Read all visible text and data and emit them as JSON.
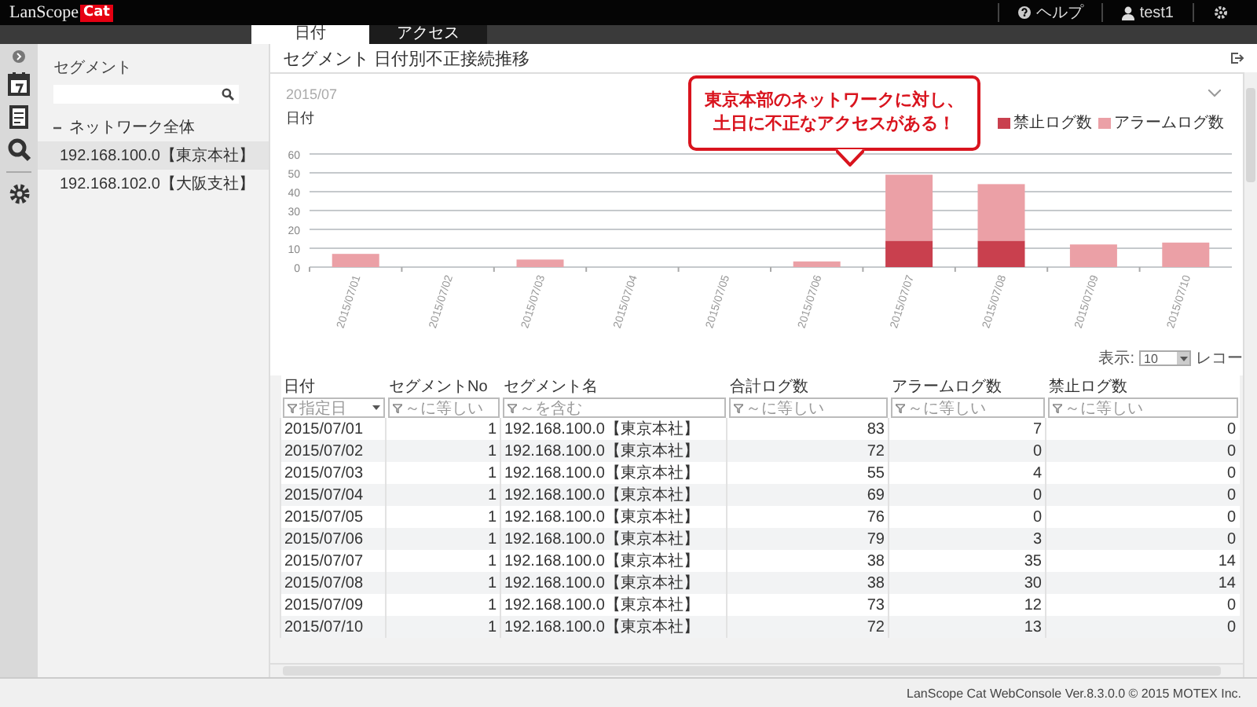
{
  "header": {
    "logo": "LanScope",
    "logo_badge": "Cat",
    "help": "ヘルプ",
    "user": "test1"
  },
  "tabs": [
    {
      "label": "日付",
      "selected": true
    },
    {
      "label": "アクセス",
      "selected": false
    }
  ],
  "sidebar": {
    "title": "セグメント",
    "tree": [
      {
        "label": "ネットワーク全体",
        "expanded": true,
        "children": [
          {
            "label": "192.168.100.0【東京本社】",
            "selected": true
          },
          {
            "label": "192.168.102.0【大阪支社】",
            "selected": false
          }
        ]
      }
    ]
  },
  "main": {
    "title": "セグメント 日付別不正接続推移",
    "period": "2015/07",
    "axis_caption": "日付",
    "callout": [
      "東京本部のネットワークに対し、",
      "土日に不正なアクセスがある！"
    ],
    "chart_data": {
      "type": "bar",
      "stacked": true,
      "categories": [
        "2015/07/01",
        "2015/07/02",
        "2015/07/03",
        "2015/07/04",
        "2015/07/05",
        "2015/07/06",
        "2015/07/07",
        "2015/07/08",
        "2015/07/09",
        "2015/07/10"
      ],
      "series": [
        {
          "name": "禁止ログ数",
          "color": "#c9404e",
          "values": [
            0,
            0,
            0,
            0,
            0,
            0,
            14,
            14,
            0,
            0
          ]
        },
        {
          "name": "アラームログ数",
          "color": "#eba0a6",
          "values": [
            7,
            0,
            4,
            0,
            0,
            3,
            35,
            30,
            12,
            13
          ]
        }
      ],
      "grid": true,
      "ylim": [
        0,
        60
      ],
      "yticks": [
        0,
        10,
        20,
        30,
        40,
        50,
        60
      ]
    },
    "page_size": {
      "label": "表示:",
      "value": "10",
      "suffix": "レコー"
    },
    "table": {
      "columns": [
        {
          "label": "日付",
          "filter": "指定日",
          "dropdown": true
        },
        {
          "label": "セグメントNo",
          "filter": "～に等しい",
          "dropdown": false
        },
        {
          "label": "セグメント名",
          "filter": "～を含む",
          "dropdown": false
        },
        {
          "label": "合計ログ数",
          "filter": "～に等しい",
          "dropdown": false
        },
        {
          "label": "アラームログ数",
          "filter": "～に等しい",
          "dropdown": false
        },
        {
          "label": "禁止ログ数",
          "filter": "～に等しい",
          "dropdown": false
        }
      ],
      "rows": [
        [
          "2015/07/01",
          "1",
          "192.168.100.0【東京本社】",
          "83",
          "7",
          "0"
        ],
        [
          "2015/07/02",
          "1",
          "192.168.100.0【東京本社】",
          "72",
          "0",
          "0"
        ],
        [
          "2015/07/03",
          "1",
          "192.168.100.0【東京本社】",
          "55",
          "4",
          "0"
        ],
        [
          "2015/07/04",
          "1",
          "192.168.100.0【東京本社】",
          "69",
          "0",
          "0"
        ],
        [
          "2015/07/05",
          "1",
          "192.168.100.0【東京本社】",
          "76",
          "0",
          "0"
        ],
        [
          "2015/07/06",
          "1",
          "192.168.100.0【東京本社】",
          "79",
          "3",
          "0"
        ],
        [
          "2015/07/07",
          "1",
          "192.168.100.0【東京本社】",
          "38",
          "35",
          "14"
        ],
        [
          "2015/07/08",
          "1",
          "192.168.100.0【東京本社】",
          "38",
          "30",
          "14"
        ],
        [
          "2015/07/09",
          "1",
          "192.168.100.0【東京本社】",
          "73",
          "12",
          "0"
        ],
        [
          "2015/07/10",
          "1",
          "192.168.100.0【東京本社】",
          "72",
          "13",
          "0"
        ]
      ]
    }
  },
  "footer": "LanScope Cat WebConsole Ver.8.3.0.0 © 2015 MOTEX Inc."
}
